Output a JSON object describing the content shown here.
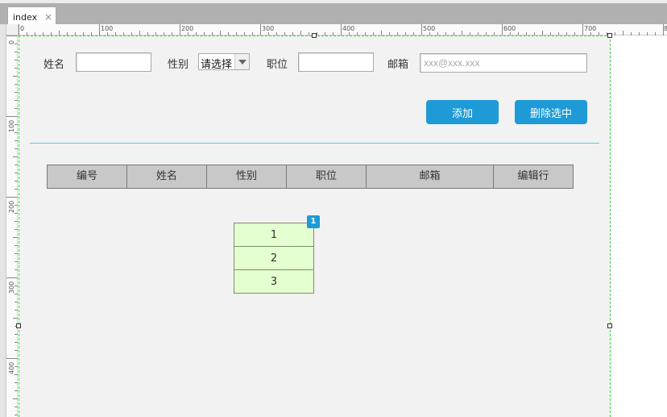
{
  "tab": {
    "title": "index",
    "close_symbol": "×"
  },
  "ruler": {
    "horizontal_labels": [
      "0",
      "100",
      "200",
      "300",
      "400",
      "500",
      "600",
      "700",
      "8"
    ],
    "vertical_labels": [
      "0",
      "100",
      "200",
      "300",
      "400"
    ]
  },
  "form": {
    "name_label": "姓名",
    "name_value": "",
    "gender_label": "性别",
    "gender_selected": "请选择",
    "position_label": "职位",
    "position_value": "",
    "email_label": "邮箱",
    "email_placeholder": "xxx@xxx.xxx"
  },
  "buttons": {
    "add": "添加",
    "delete_selected": "删除选中"
  },
  "table": {
    "headers": [
      "编号",
      "姓名",
      "性别",
      "职位",
      "邮箱",
      "编辑行"
    ]
  },
  "pager": {
    "items": [
      "1",
      "2",
      "3"
    ],
    "badge": "1"
  },
  "colors": {
    "accent": "#1e9ad6",
    "guide": "#3fd13f",
    "divider": "#5bc8e0",
    "pager_fill": "#e4ffd0"
  }
}
